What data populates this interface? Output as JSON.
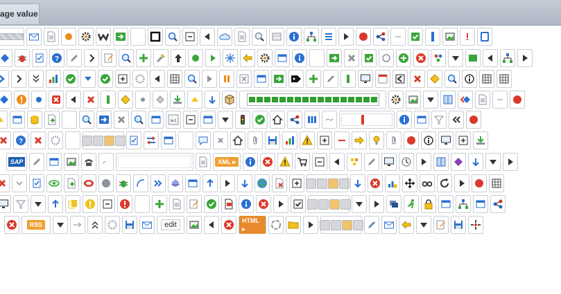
{
  "tab": {
    "label": "age value"
  },
  "badges": {
    "xml": "XML ▸",
    "rss": "RSS",
    "html": "HTML ▸",
    "sap": "SAP",
    "edit": "edit",
    "checkbox_a": "a-z"
  },
  "colors": {
    "blue": "#2a6fd1",
    "green": "#3aa63a",
    "red": "#d93a2b",
    "orange": "#f08a1c",
    "yellow": "#f2c21b",
    "gray": "#8b929c",
    "dark": "#333333",
    "progress": "#2e9e2e"
  },
  "icon_rows": [
    [
      "bar-icon",
      "envelope-open-icon",
      "document-icon",
      "orange-dot-icon",
      "gear-icon",
      "w-logo-icon",
      "green-exit-icon",
      "blank-icon",
      "black-square-icon",
      "magnifier-icon",
      "minus-box-icon",
      "triangle-left-icon",
      "cloud-icon",
      "document-lines-icon",
      "magnifier-gray-icon",
      "form-icon",
      "info-icon",
      "tree-icon",
      "list-icon",
      "triangle-right-icon",
      "red-circle-icon",
      "purple-flow-icon",
      "dash-icon",
      "green-check-box-icon",
      "blue-vertical-bar-icon",
      "image-frame-icon",
      "exclamation-icon",
      "blue-square-icon"
    ],
    [
      "diamond-icon",
      "bug-icon",
      "checklist-icon",
      "help-icon",
      "pencil-icon",
      "chevron-right-icon",
      "edit-note-icon",
      "magnifier-icon",
      "green-add-icon",
      "tool-icon",
      "upload-icon",
      "green-dot-icon",
      "play-icon",
      "sparkle-icon",
      "back-arrow-icon",
      "gear-small-icon",
      "window-icon",
      "info-icon",
      "blank-icon",
      "green-arrow-box-icon",
      "close-x-icon",
      "green-check-box-icon",
      "circle-icon",
      "green-plus-circle-icon",
      "red-x-circle-icon",
      "diamonds-icon",
      "triangle-down-icon",
      "green-rect-icon",
      "triangle-left-icon",
      "hierarchy-icon",
      "triangle-right-icon"
    ],
    [
      "arrow-right-icon",
      "chevron-right-icon",
      "chevrons-down-icon",
      "chart-icon",
      "green-check-icon",
      "dropdown-icon",
      "green-check-small-icon",
      "plus-box-icon",
      "spinner-icon",
      "triangle-left-icon",
      "calculator-icon",
      "magnifier-icon",
      "play-gray-icon",
      "pause-icon",
      "close-box-icon",
      "settings-window-icon",
      "green-export-icon",
      "tag-icon",
      "green-plus-icon",
      "pencil-icon",
      "green-bar-icon",
      "monitor-icon",
      "calendar-red-icon",
      "back-box-icon",
      "red-x-icon",
      "warning-diamond-icon",
      "magnifier-icon",
      "info-outline-icon",
      "table-icon",
      "table-icon"
    ],
    [
      "blue-diamond-icon",
      "orange-exclamation-icon",
      "blue-dot-icon",
      "red-x-box-icon",
      "triangle-left-icon",
      "red-x-icon",
      "green-bar-icon",
      "yellow-diamond-icon",
      "dot-icon",
      "gray-diamond-icon",
      "download-icon",
      "triangle-up-icon",
      "down-arrow-icon",
      "cube-icon",
      "progress-bar",
      "settings-icon",
      "picture-icon",
      "triangle-down-icon",
      "book-icon",
      "diamond-left-icon",
      "document-icon",
      "dash-icon",
      "red-circle-icon"
    ],
    [
      "triangle-up-icon",
      "window-icon",
      "cylinder-icon",
      "add-document-icon",
      "blank-icon",
      "magnifier-icon",
      "blue-arrow-icon",
      "close-x-icon",
      "magnifier-icon",
      "window-icon",
      "sort-icon",
      "minus-box-icon",
      "window-icon",
      "triangle-down-icon",
      "traffic-light-icon",
      "green-check-icon",
      "home-icon",
      "share-icon",
      "columns-icon",
      "tilde-icon",
      "red-indicator-input",
      "info-icon",
      "settings-window-icon",
      "filter-icon",
      "double-left-icon",
      "red-circle-icon"
    ],
    [
      "red-x-icon",
      "help-icon",
      "red-x-icon",
      "spinner-icon",
      "blank-icon",
      "segmented-button",
      "checklist-icon",
      "move-icon",
      "window-icon",
      "blank-icon",
      "chat-icon",
      "close-small-icon",
      "home-icon",
      "paperclip-icon",
      "save-icon",
      "bar-chart-icon",
      "warning-icon",
      "plus-box-icon",
      "red-minus-icon",
      "yellow-arrow-icon",
      "bulb-icon",
      "paperclip-icon",
      "red-circle-icon",
      "info-circle-icon",
      "screen-icon",
      "plus-box-icon",
      "download-icon"
    ],
    [
      "sap-badge",
      "pencil-icon",
      "window-icon",
      "picture-icon",
      "phone-icon",
      "check-dash-icon",
      "blank-input",
      "document-lines-icon",
      "xml-badge",
      "info-icon",
      "red-x-circle-icon",
      "warning-icon",
      "cart-icon",
      "minus-box-icon",
      "triangle-left-icon",
      "puzzle-icon",
      "pencil-icon",
      "monitor-icon",
      "clock-icon",
      "triangle-right-icon",
      "book-icon",
      "purple-diamond-icon",
      "down-arrow-icon",
      "triangle-down-icon",
      "triangle-right-icon"
    ],
    [
      "red-x-icon",
      "chevron-down-icon",
      "checklist-icon",
      "eye-icon",
      "add-document-icon",
      "stop-icon",
      "gray-circle-icon",
      "bug-green-icon",
      "curve-icon",
      "chevrons-right-icon",
      "layers-icon",
      "window-icon",
      "up-arrow-icon",
      "triangle-right-icon",
      "down-arrow-icon",
      "globe-icon",
      "delete-document-icon",
      "plus-box-icon",
      "segmented-button",
      "down-arrow-icon",
      "close-circle-icon",
      "chart-settings-icon",
      "move-arrows-icon",
      "glasses-icon",
      "refresh-icon",
      "triangle-right-icon",
      "red-circle-icon",
      "table-icon"
    ],
    [
      "monitor-icon",
      "filter-icon",
      "triangle-down-icon",
      "up-arrow-icon",
      "copy-icon",
      "exclamation-box-icon",
      "minus-box-icon",
      "red-alert-icon",
      "blank-icon",
      "green-plus-icon",
      "document-icon",
      "edit-note-icon",
      "green-check-icon",
      "file-pdf-icon",
      "info-icon",
      "red-x-circle-icon",
      "triangle-right-icon",
      "checkbox-icon",
      "segmented-button",
      "triangle-down-icon",
      "triangle-right-icon",
      "cards-icon",
      "runner-icon",
      "lock-icon",
      "window-icon",
      "hierarchy-icon",
      "window-icon",
      "share-icon"
    ],
    [
      "red-x-circle-icon",
      "rss-badge",
      "triangle-down-icon",
      "arrow-dots-icon",
      "chevrons-up-icon",
      "spinner-icon",
      "save-icon",
      "envelope-icon",
      "edit-button",
      "picture-icon",
      "triangle-left-icon",
      "red-x-circle-icon",
      "html-badge",
      "recycle-icon",
      "folder-icon",
      "triangle-right-icon",
      "segmented-button",
      "pen-icon",
      "envelope-icon",
      "back-arrow-icon",
      "triangle-down-icon",
      "edit-note-icon",
      "save-icon",
      "crosshair-icon"
    ]
  ]
}
